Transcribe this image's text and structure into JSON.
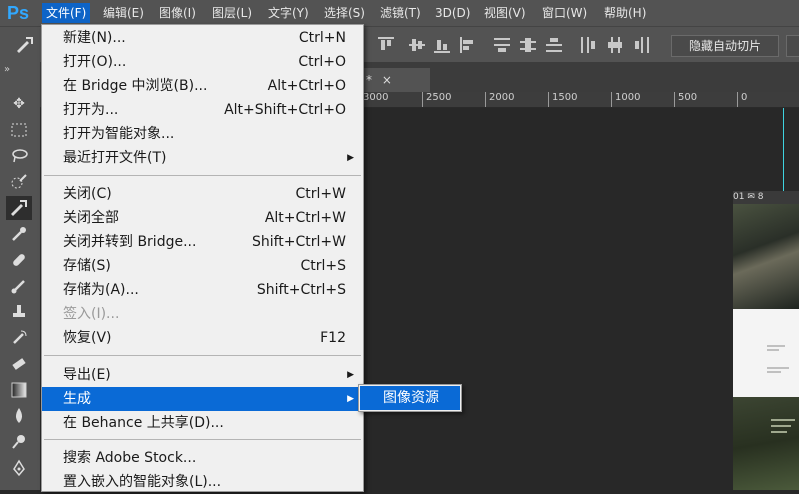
{
  "menubar": {
    "logo": "Ps",
    "items": [
      {
        "label": "文件(F)",
        "active": true
      },
      {
        "label": "编辑(E)"
      },
      {
        "label": "图像(I)"
      },
      {
        "label": "图层(L)"
      },
      {
        "label": "文字(Y)"
      },
      {
        "label": "选择(S)"
      },
      {
        "label": "滤镜(T)"
      },
      {
        "label": "3D(D)"
      },
      {
        "label": "视图(V)"
      },
      {
        "label": "窗口(W)"
      },
      {
        "label": "帮助(H)"
      }
    ]
  },
  "options": {
    "auto_slice_label": "隐藏自动切片"
  },
  "tab": {
    "label": "*",
    "close": "×"
  },
  "ruler": {
    "ticks": [
      "3000",
      "2500",
      "2000",
      "1500",
      "1000",
      "500",
      "0"
    ]
  },
  "doc": {
    "header": "01 ✉ 8"
  },
  "file_menu": {
    "items": [
      {
        "label": "新建(N)...",
        "shortcut": "Ctrl+N"
      },
      {
        "label": "打开(O)...",
        "shortcut": "Ctrl+O"
      },
      {
        "label": "在 Bridge 中浏览(B)...",
        "shortcut": "Alt+Ctrl+O"
      },
      {
        "label": "打开为...",
        "shortcut": "Alt+Shift+Ctrl+O"
      },
      {
        "label": "打开为智能对象...",
        "shortcut": ""
      },
      {
        "label": "最近打开文件(T)",
        "shortcut": "",
        "submenu": true
      },
      {
        "label": "关闭(C)",
        "shortcut": "Ctrl+W"
      },
      {
        "label": "关闭全部",
        "shortcut": "Alt+Ctrl+W"
      },
      {
        "label": "关闭并转到 Bridge...",
        "shortcut": "Shift+Ctrl+W"
      },
      {
        "label": "存储(S)",
        "shortcut": "Ctrl+S"
      },
      {
        "label": "存储为(A)...",
        "shortcut": "Shift+Ctrl+S"
      },
      {
        "label": "签入(I)...",
        "shortcut": "",
        "disabled": true
      },
      {
        "label": "恢复(V)",
        "shortcut": "F12"
      },
      {
        "label": "导出(E)",
        "shortcut": "",
        "submenu": true
      },
      {
        "label": "生成",
        "shortcut": "",
        "submenu": true,
        "highlighted": true
      },
      {
        "label": "在 Behance 上共享(D)...",
        "shortcut": ""
      },
      {
        "label": "搜索 Adobe Stock...",
        "shortcut": ""
      },
      {
        "label": "置入嵌入的智能对象(L)...",
        "shortcut": ""
      }
    ]
  },
  "generate_submenu": {
    "items": [
      {
        "label": "图像资源"
      }
    ]
  },
  "colors": {
    "menu_highlight": "#0a6ad6",
    "guide": "#3fd4e0",
    "chrome": "#535353",
    "canvas": "#282828"
  }
}
